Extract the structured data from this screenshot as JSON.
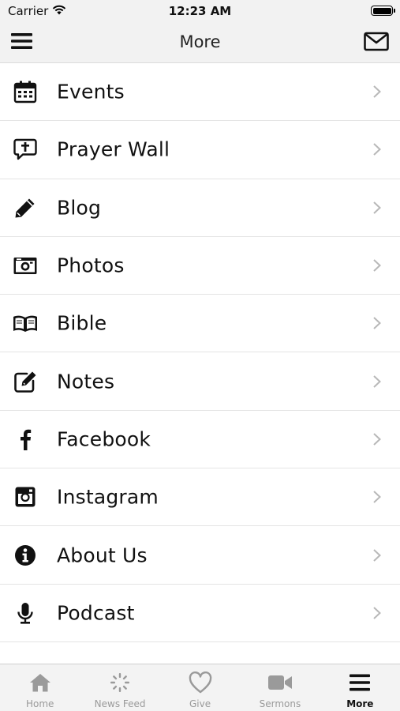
{
  "status": {
    "carrier": "Carrier",
    "time": "12:23 AM"
  },
  "nav": {
    "title": "More"
  },
  "menu_items": [
    {
      "label": "Events",
      "icon": "calendar-icon"
    },
    {
      "label": "Prayer Wall",
      "icon": "prayer-bubble-icon"
    },
    {
      "label": "Blog",
      "icon": "pencil-icon"
    },
    {
      "label": "Photos",
      "icon": "camera-icon"
    },
    {
      "label": "Bible",
      "icon": "book-icon"
    },
    {
      "label": "Notes",
      "icon": "edit-note-icon"
    },
    {
      "label": "Facebook",
      "icon": "facebook-icon"
    },
    {
      "label": "Instagram",
      "icon": "instagram-icon"
    },
    {
      "label": "About Us",
      "icon": "info-icon"
    },
    {
      "label": "Podcast",
      "icon": "microphone-icon"
    }
  ],
  "tabs": [
    {
      "label": "Home",
      "icon": "home-icon",
      "active": false
    },
    {
      "label": "News Feed",
      "icon": "refresh-icon",
      "active": false
    },
    {
      "label": "Give",
      "icon": "heart-icon",
      "active": false
    },
    {
      "label": "Sermons",
      "icon": "video-camera-icon",
      "active": false
    },
    {
      "label": "More",
      "icon": "hamburger-icon",
      "active": true
    }
  ],
  "colors": {
    "bar_bg": "#f2f2f2",
    "inactive_tab": "#9a9a9a",
    "active_tab": "#111111",
    "chevron": "#b8b8b8"
  }
}
